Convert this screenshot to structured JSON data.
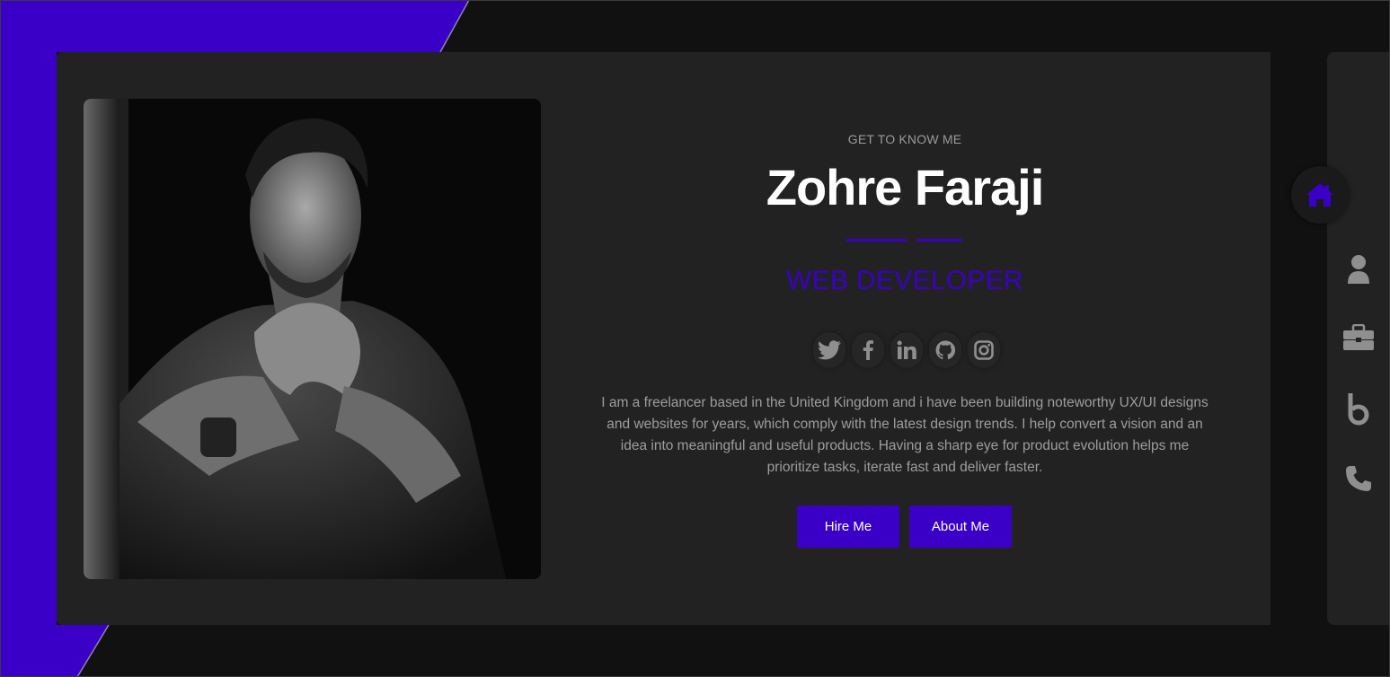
{
  "colors": {
    "accent": "#3b00c7",
    "background": "#111111",
    "card": "#222222",
    "icon_muted": "#8f8f8f",
    "text_muted": "#9d9d9d"
  },
  "profile": {
    "eyebrow": "GET TO KNOW ME",
    "name": "Zohre Faraji",
    "role": "WEB DEVELOPER",
    "bio": "I am a freelancer based in the United Kingdom and i have been building noteworthy UX/UI designs and websites for years, which comply with the latest design trends. I help convert a vision and an idea into meaningful and useful products. Having a sharp eye for product evolution helps me prioritize tasks, iterate fast and deliver faster.",
    "photo_icon": "portrait-photo"
  },
  "socials": [
    {
      "icon": "twitter-icon"
    },
    {
      "icon": "facebook-icon"
    },
    {
      "icon": "linkedin-icon"
    },
    {
      "icon": "github-icon"
    },
    {
      "icon": "instagram-icon"
    }
  ],
  "buttons": {
    "hire": "Hire Me",
    "about": "About Me"
  },
  "nav": [
    {
      "icon": "home-icon",
      "active": true
    },
    {
      "icon": "user-icon",
      "active": false
    },
    {
      "icon": "briefcase-icon",
      "active": false
    },
    {
      "icon": "blog-icon",
      "active": false
    },
    {
      "icon": "phone-icon",
      "active": false
    }
  ]
}
